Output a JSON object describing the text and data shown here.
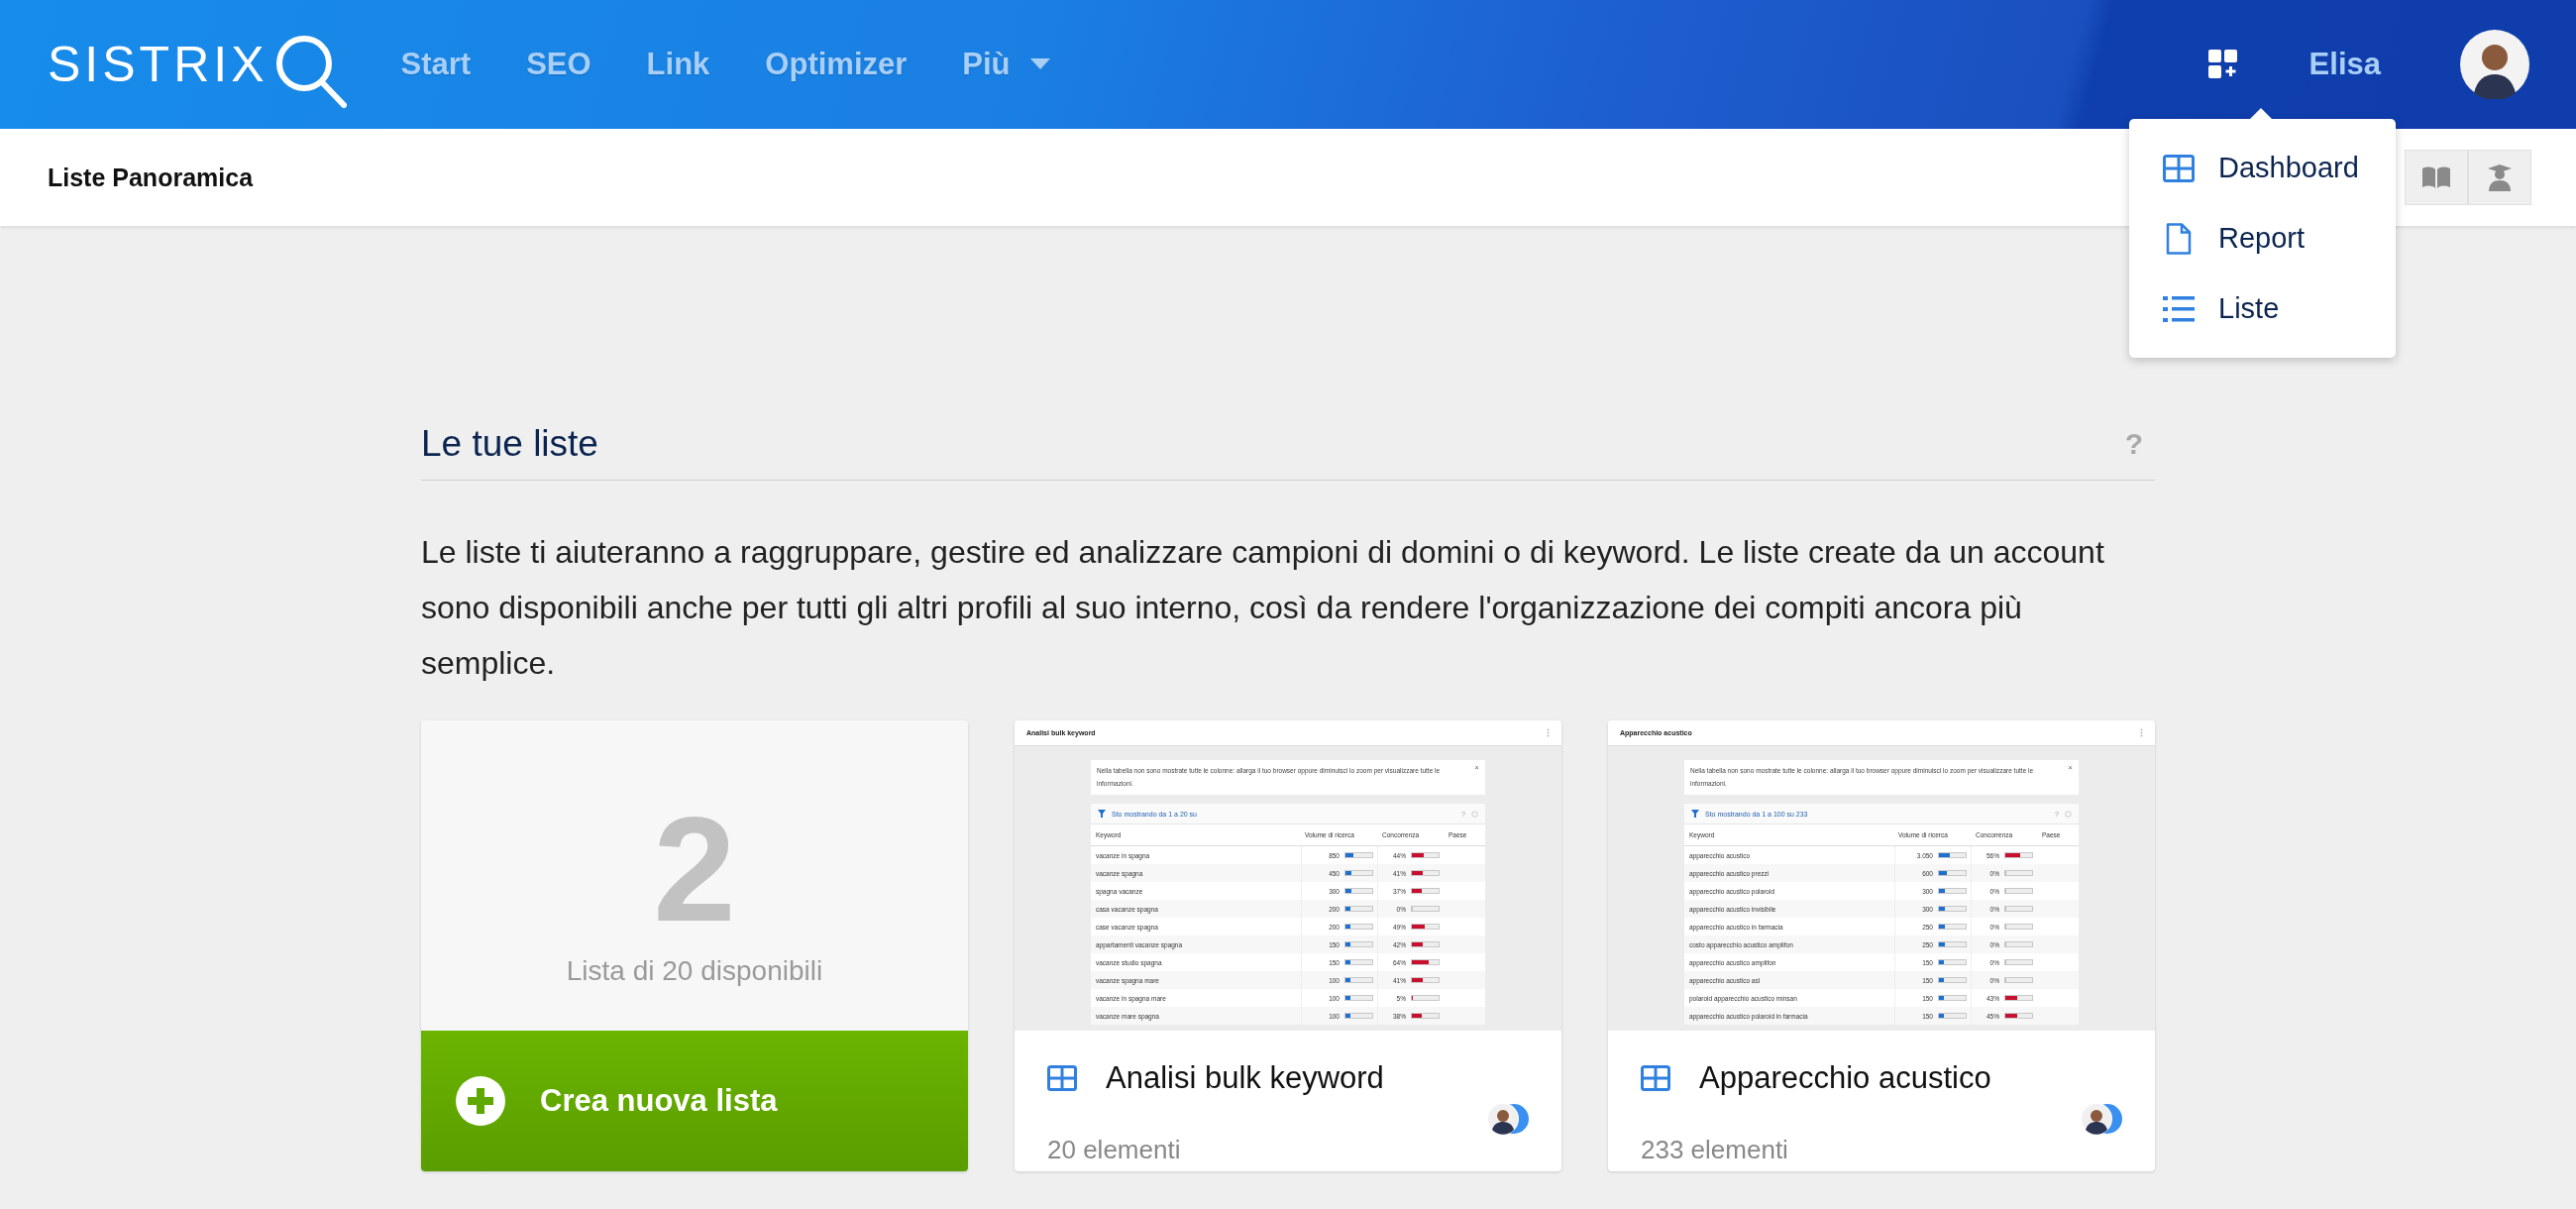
{
  "header": {
    "logo": "SISTRIX",
    "nav": [
      "Start",
      "SEO",
      "Link",
      "Optimizer"
    ],
    "more": "Più",
    "user": "Elisa"
  },
  "dropdown": {
    "items": [
      {
        "label": "Dashboard",
        "kind": "dashboard"
      },
      {
        "label": "Report",
        "kind": "report"
      },
      {
        "label": "Liste",
        "kind": "list"
      }
    ]
  },
  "subheader": {
    "title": "Liste Panoramica"
  },
  "section": {
    "title": "Le tue liste",
    "help": "?",
    "description": "Le liste ti aiuteranno a raggruppare, gestire ed analizzare campioni di domini o di keyword. Le liste create da un account sono disponibili anche per tutti gli altri profili al suo interno, così da rendere l'organizzazione dei compiti ancora più semplice."
  },
  "create_card": {
    "count": "2",
    "caption": "Lista di 20 disponibili",
    "action": "Crea nuova lista"
  },
  "lists": [
    {
      "name": "Analisi bulk keyword",
      "count": "20 elementi",
      "preview": {
        "title": "Analisi bulk keyword",
        "notice": "Nella tabella non sono mostrate tutte le colonne: allarga il tuo browser oppure diminuisci lo zoom per visualizzare tutte le informazioni.",
        "close": "×",
        "filter_text": "Sto mostrando da 1 a 20 su",
        "help": "?",
        "columns": [
          "Keyword",
          "Volume di ricerca",
          "Concorrenza",
          "Paese"
        ],
        "rows": [
          {
            "keyword": "vacanze in spagna",
            "volume": "850",
            "volume_bar": {
              "level": 0.3
            },
            "competition": "44%",
            "competition_bar": {
              "level": 0.44
            }
          },
          {
            "keyword": "vacanze spagna",
            "volume": "450",
            "volume_bar": {
              "level": 0.24
            },
            "competition": "41%",
            "competition_bar": {
              "level": 0.41
            }
          },
          {
            "keyword": "spagna vacanze",
            "volume": "300",
            "volume_bar": {
              "level": 0.24
            },
            "competition": "37%",
            "competition_bar": {
              "level": 0.37
            }
          },
          {
            "keyword": "casa vacanze spagna",
            "volume": "200",
            "volume_bar": {
              "level": 0.18
            },
            "competition": "0%",
            "competition_bar": {
              "level": 0
            }
          },
          {
            "keyword": "case vacanze spagna",
            "volume": "200",
            "volume_bar": {
              "level": 0.18
            },
            "competition": "49%",
            "competition_bar": {
              "level": 0.49
            }
          },
          {
            "keyword": "appartamenti vacanze spagna",
            "volume": "150",
            "volume_bar": {
              "level": 0.18
            },
            "competition": "42%",
            "competition_bar": {
              "level": 0.42
            }
          },
          {
            "keyword": "vacanze studio spagna",
            "volume": "150",
            "volume_bar": {
              "level": 0.18
            },
            "competition": "64%",
            "competition_bar": {
              "level": 0.64
            }
          },
          {
            "keyword": "vacanze spagna mare",
            "volume": "100",
            "volume_bar": {
              "level": 0.18
            },
            "competition": "41%",
            "competition_bar": {
              "level": 0.41
            }
          },
          {
            "keyword": "vacanze in spagna mare",
            "volume": "100",
            "volume_bar": {
              "level": 0.18
            },
            "competition": "5%",
            "competition_bar": {
              "level": 0.05
            }
          },
          {
            "keyword": "vacanze mare spagna",
            "volume": "100",
            "volume_bar": {
              "level": 0.18
            },
            "competition": "38%",
            "competition_bar": {
              "level": 0.38
            }
          }
        ]
      }
    },
    {
      "name": "Apparecchio acustico",
      "count": "233 elementi",
      "preview": {
        "title": "Apparecchio acustico",
        "notice": "Nella tabella non sono mostrate tutte le colonne: allarga il tuo browser oppure diminuisci lo zoom per visualizzare tutte le informazioni.",
        "close": "×",
        "filter_text": "Sto mostrando da 1 a 100 su 233",
        "help": "?",
        "columns": [
          "Keyword",
          "Volume di ricerca",
          "Concorrenza",
          "Paese"
        ],
        "rows": [
          {
            "keyword": "apparecchio acustico",
            "volume": "3.050",
            "volume_bar": {
              "level": 0.42
            },
            "competition": "56%",
            "competition_bar": {
              "level": 0.56
            }
          },
          {
            "keyword": "apparecchio acustico prezzi",
            "volume": "600",
            "volume_bar": {
              "level": 0.3
            },
            "competition": "0%",
            "competition_bar": {
              "level": 0
            }
          },
          {
            "keyword": "apparecchio acustico polaroid",
            "volume": "300",
            "volume_bar": {
              "level": 0.24
            },
            "competition": "0%",
            "competition_bar": {
              "level": 0
            }
          },
          {
            "keyword": "apparecchio acustico invisibile",
            "volume": "300",
            "volume_bar": {
              "level": 0.24
            },
            "competition": "0%",
            "competition_bar": {
              "level": 0
            }
          },
          {
            "keyword": "apparecchio acustico in farmacia",
            "volume": "250",
            "volume_bar": {
              "level": 0.24
            },
            "competition": "0%",
            "competition_bar": {
              "level": 0
            }
          },
          {
            "keyword": "costo apparecchio acustico amplifon",
            "volume": "250",
            "volume_bar": {
              "level": 0.24
            },
            "competition": "0%",
            "competition_bar": {
              "level": 0
            }
          },
          {
            "keyword": "apparecchio acustico amplifon",
            "volume": "150",
            "volume_bar": {
              "level": 0.18
            },
            "competition": "0%",
            "competition_bar": {
              "level": 0
            }
          },
          {
            "keyword": "apparecchio acustico asl",
            "volume": "150",
            "volume_bar": {
              "level": 0.18
            },
            "competition": "0%",
            "competition_bar": {
              "level": 0
            }
          },
          {
            "keyword": "polaroid apparecchio acustico minsan",
            "volume": "150",
            "volume_bar": {
              "level": 0.18
            },
            "competition": "43%",
            "competition_bar": {
              "level": 0.43
            }
          },
          {
            "keyword": "apparecchio acustico polaroid in farmacia",
            "volume": "150",
            "volume_bar": {
              "level": 0.18
            },
            "competition": "45%",
            "competition_bar": {
              "level": 0.45
            }
          }
        ]
      }
    }
  ]
}
